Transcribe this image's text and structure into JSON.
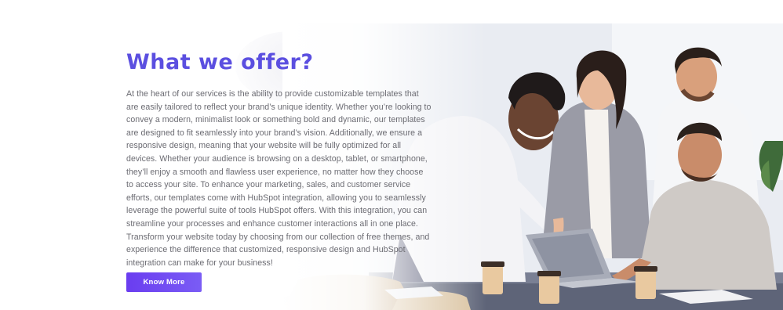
{
  "section": {
    "title": "What we offer?",
    "paragraph": "At the heart of our services is the ability to provide customizable templates that are easily tailored to reflect your brand’s unique identity. Whether you’re looking to convey a modern, minimalist look or something bold and dynamic, our templates are designed to fit seamlessly into your brand’s vision. Additionally, we ensure a responsive design, meaning that your website will be fully optimized for all devices. Whether your audience is browsing on a desktop, tablet, or smartphone, they’ll enjoy a smooth and flawless user experience, no matter how they choose to access your site. To enhance your marketing, sales, and customer service efforts, our templates come with HubSpot integration, allowing you to seamlessly leverage the powerful suite of tools HubSpot offers. With this integration, you can streamline your processes and enhance customer interactions all in one place. Transform your website today by choosing from our collection of free themes, and experience the difference that customized, responsive design and HubSpot integration can make for your business!",
    "cta_label": "Know More"
  },
  "colors": {
    "title": "#5b4fe0",
    "button_start": "#6a3df0",
    "button_end": "#7a5cf5",
    "body_text": "#6b6b72"
  },
  "image": {
    "subject": "team-collaborating-at-laptop-photo"
  }
}
